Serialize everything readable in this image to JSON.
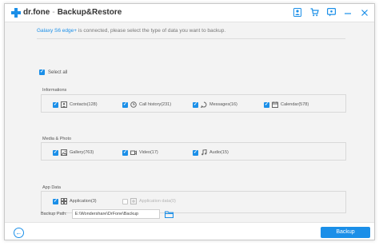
{
  "titlebar": {
    "brand": "dr.fone",
    "separator": "-",
    "title": "Backup&Restore",
    "icons": [
      "account-icon",
      "cart-icon",
      "feedback-icon",
      "minimize-icon",
      "close-icon"
    ]
  },
  "message": {
    "device": "Galaxy S6 edge+",
    "text": " is connected, please select the type of data you want to backup."
  },
  "select_all": {
    "label": "Select all",
    "checked": true
  },
  "groups": [
    {
      "label": "Informations",
      "items": [
        {
          "label": "Contacts(128)",
          "icon": "contacts-icon",
          "checked": true,
          "enabled": true
        },
        {
          "label": "Call history(231)",
          "icon": "call-history-icon",
          "checked": true,
          "enabled": true
        },
        {
          "label": "Messages(16)",
          "icon": "messages-icon",
          "checked": true,
          "enabled": true
        },
        {
          "label": "Calendar(578)",
          "icon": "calendar-icon",
          "checked": true,
          "enabled": true
        }
      ]
    },
    {
      "label": "Media & Photo",
      "items": [
        {
          "label": "Gallery(763)",
          "icon": "gallery-icon",
          "checked": true,
          "enabled": true
        },
        {
          "label": "Video(17)",
          "icon": "video-icon",
          "checked": true,
          "enabled": true
        },
        {
          "label": "Audio(15)",
          "icon": "audio-icon",
          "checked": true,
          "enabled": true
        }
      ]
    },
    {
      "label": "App Data",
      "items": [
        {
          "label": "Application(3)",
          "icon": "application-icon",
          "checked": true,
          "enabled": true
        },
        {
          "label": "Application data(0)",
          "icon": "application-data-icon",
          "checked": false,
          "enabled": false
        }
      ]
    }
  ],
  "backup_path": {
    "label": "Backup Path:",
    "value": "E:\\Wondershare\\DrFone\\Backup"
  },
  "footer": {
    "backup_label": "Backup"
  },
  "colors": {
    "accent": "#1b8fe8",
    "background": "#f3f3f3"
  }
}
